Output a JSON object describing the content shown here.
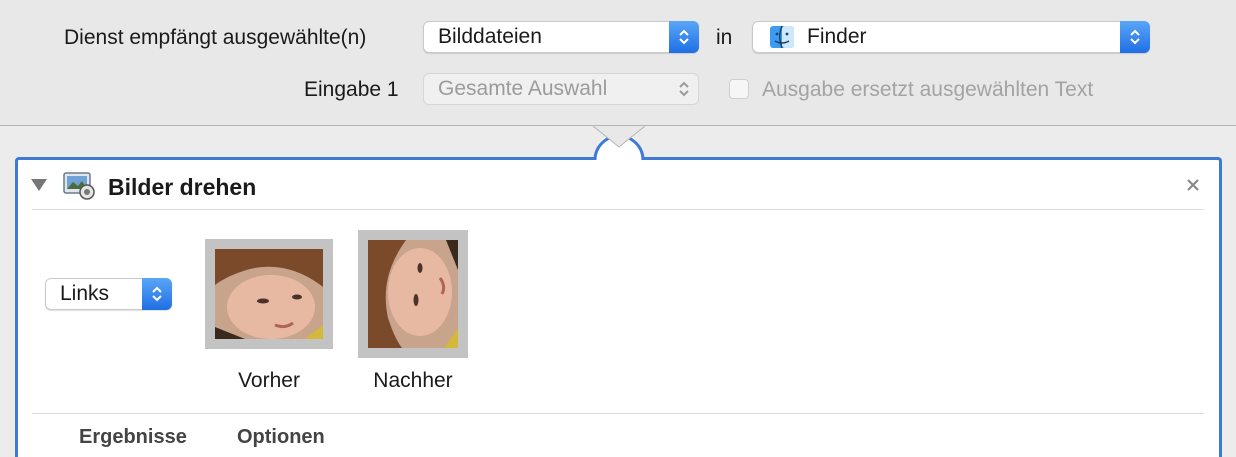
{
  "service": {
    "receives_label": "Dienst empfängt ausgewählte(n)",
    "input_type": "Bilddateien",
    "in_label": "in",
    "application": "Finder",
    "input_label": "Eingabe 1",
    "input_scope": "Gesamte Auswahl",
    "replace_label": "Ausgabe ersetzt ausgewählten Text",
    "replace_checked": false
  },
  "action": {
    "title": "Bilder drehen",
    "close_icon": "close-icon",
    "direction": "Links",
    "before_label": "Vorher",
    "after_label": "Nachher",
    "tabs": [
      "Ergebnisse",
      "Optionen"
    ]
  },
  "colors": {
    "accent": "#3c7ad6",
    "stepper": "#2f7ff0"
  }
}
